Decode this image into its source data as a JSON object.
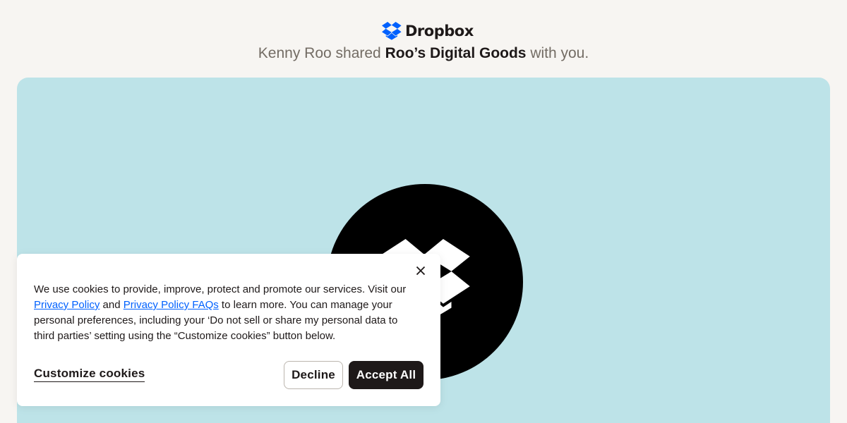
{
  "brand": {
    "name": "Dropbox",
    "color": "#0061fe"
  },
  "share": {
    "sharer": "Kenny Roo",
    "verb": "shared",
    "item": "Roo’s Digital Goods",
    "suffix": "with you."
  },
  "preview": {
    "background": "#bde3e8",
    "icon": "dropbox-logo-icon"
  },
  "cookie_banner": {
    "text_1": "We use cookies to provide, improve, protect and promote our services. Visit our ",
    "link_privacy": "Privacy Policy",
    "text_2": " and ",
    "link_faqs": "Privacy Policy FAQs",
    "text_3": " to learn more. You can manage your personal preferences, including your ‘Do not sell or share my personal data to third parties’ setting using the “Customize cookies” button below.",
    "customize_label": "Customize cookies",
    "decline_label": "Decline",
    "accept_label": "Accept All",
    "close_icon": "close-icon"
  }
}
